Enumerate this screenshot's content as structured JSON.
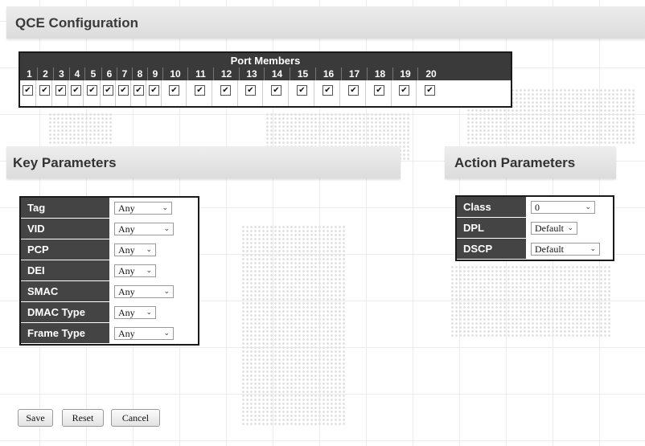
{
  "page_title": "QCE Configuration",
  "port_members": {
    "title": "Port Members",
    "ports": [
      "1",
      "2",
      "3",
      "4",
      "5",
      "6",
      "7",
      "8",
      "9",
      "10",
      "11",
      "12",
      "13",
      "14",
      "15",
      "16",
      "17",
      "18",
      "19",
      "20"
    ],
    "checked": [
      true,
      true,
      true,
      true,
      true,
      true,
      true,
      true,
      true,
      true,
      true,
      true,
      true,
      true,
      true,
      true,
      true,
      true,
      true,
      true
    ],
    "check_glyph": "✔"
  },
  "key_parameters": {
    "title": "Key Parameters",
    "rows": [
      {
        "label": "Tag",
        "value": "Any"
      },
      {
        "label": "VID",
        "value": "Any"
      },
      {
        "label": "PCP",
        "value": "Any"
      },
      {
        "label": "DEI",
        "value": "Any"
      },
      {
        "label": "SMAC",
        "value": "Any"
      },
      {
        "label": "DMAC Type",
        "value": "Any"
      },
      {
        "label": "Frame Type",
        "value": "Any"
      }
    ]
  },
  "action_parameters": {
    "title": "Action Parameters",
    "rows": [
      {
        "label": "Class",
        "value": "0"
      },
      {
        "label": "DPL",
        "value": "Default"
      },
      {
        "label": "DSCP",
        "value": "Default"
      }
    ]
  },
  "buttons": {
    "save": "Save",
    "reset": "Reset",
    "cancel": "Cancel"
  },
  "chevron_glyph": "⌄"
}
